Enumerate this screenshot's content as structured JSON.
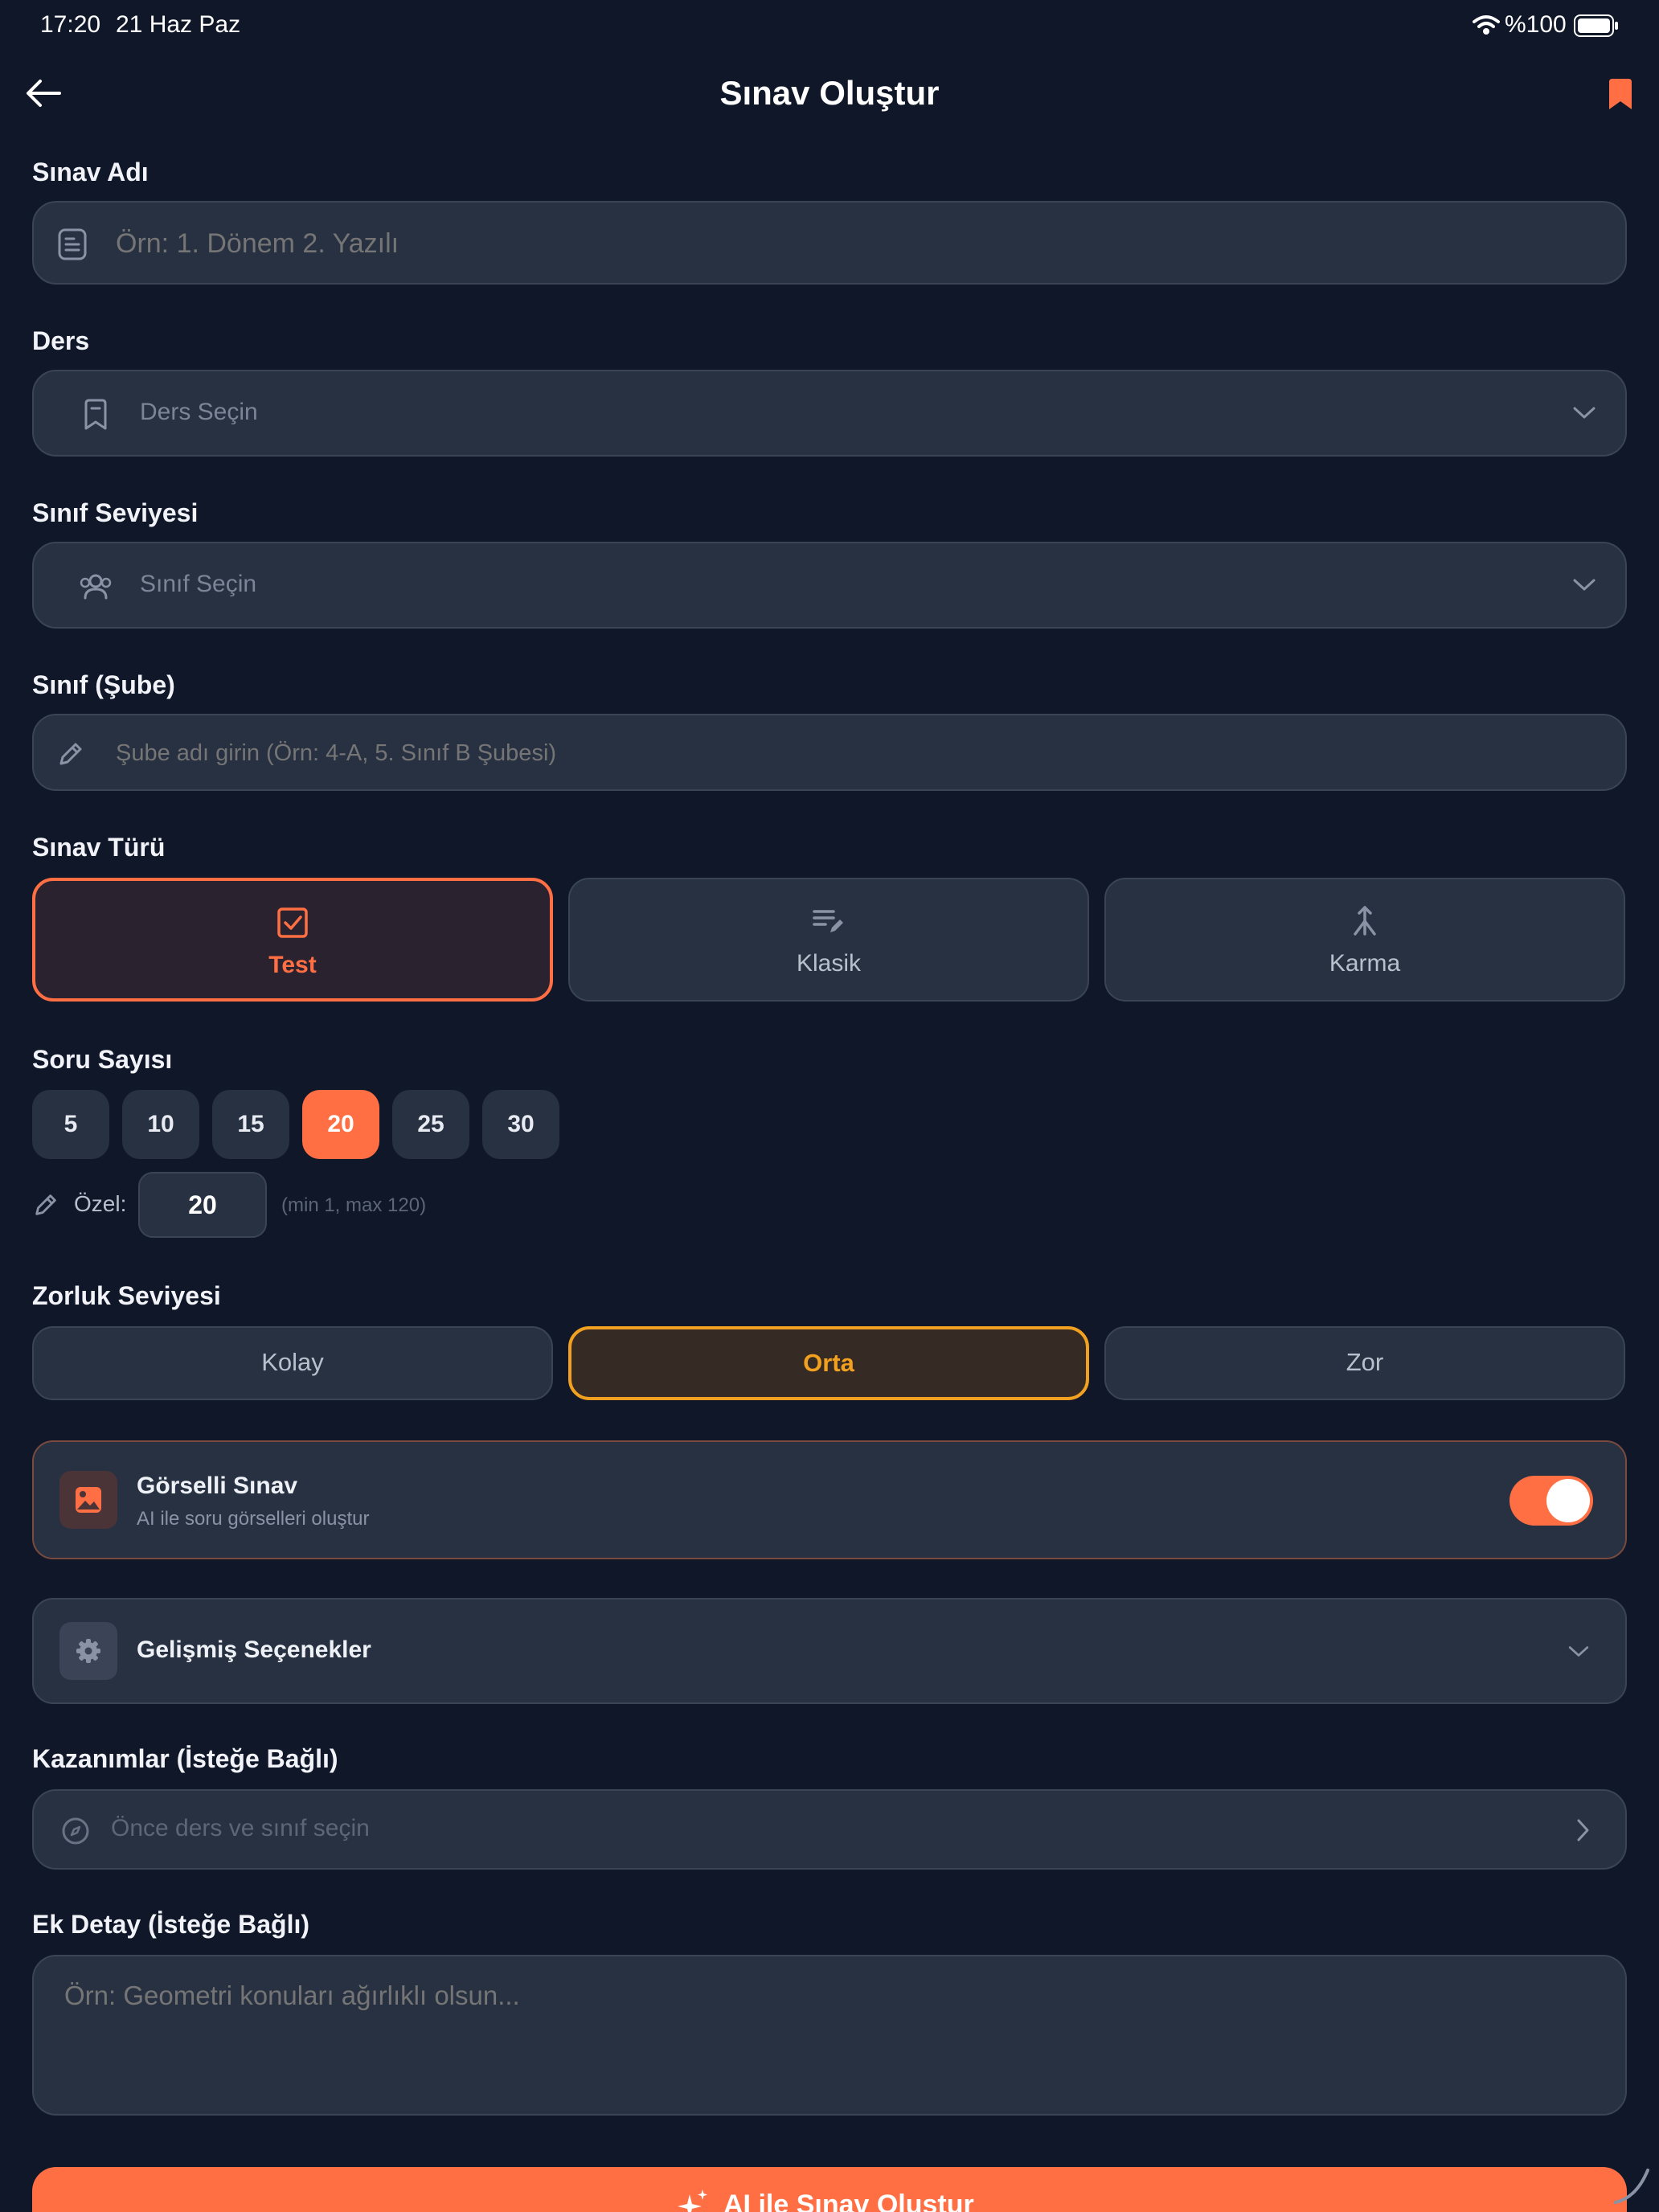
{
  "status_bar": {
    "time": "17:20",
    "date": "21 Haz Paz",
    "battery": "%100"
  },
  "header": {
    "title": "Sınav Oluştur"
  },
  "exam_name": {
    "label": "Sınav Adı",
    "placeholder": "Örn: 1. Dönem 2. Yazılı",
    "value": ""
  },
  "course": {
    "label": "Ders",
    "placeholder": "Ders Seçin"
  },
  "grade_level": {
    "label": "Sınıf Seviyesi",
    "placeholder": "Sınıf Seçin"
  },
  "branch": {
    "label": "Sınıf (Şube)",
    "placeholder": "Şube adı girin (Örn: 4-A, 5. Sınıf B Şubesi)",
    "value": ""
  },
  "exam_type": {
    "label": "Sınav Türü",
    "options": [
      {
        "label": "Test",
        "icon": "checkbox-icon",
        "selected": true
      },
      {
        "label": "Klasik",
        "icon": "edit-lines-icon",
        "selected": false
      },
      {
        "label": "Karma",
        "icon": "merge-icon",
        "selected": false
      }
    ]
  },
  "question_count": {
    "label": "Soru Sayısı",
    "options": [
      "5",
      "10",
      "15",
      "20",
      "25",
      "30"
    ],
    "selected": "20",
    "custom_label": "Özel:",
    "custom_value": "20",
    "custom_hint": "(min 1, max 120)"
  },
  "difficulty": {
    "label": "Zorluk Seviyesi",
    "options": [
      {
        "label": "Kolay",
        "selected": false
      },
      {
        "label": "Orta",
        "selected": true
      },
      {
        "label": "Zor",
        "selected": false
      }
    ]
  },
  "visual_exam": {
    "title": "Görselli Sınav",
    "subtitle": "AI ile soru görselleri oluştur",
    "enabled": true
  },
  "advanced": {
    "title": "Gelişmiş Seçenekler"
  },
  "outcomes": {
    "label": "Kazanımlar (İsteğe Bağlı)",
    "placeholder": "Önce ders ve sınıf seçin"
  },
  "extra_detail": {
    "label": "Ek Detay (İsteğe Bağlı)",
    "placeholder": "Örn: Geometri konuları ağırlıklı olsun..."
  },
  "submit": {
    "label": "AI ile Sınav Oluştur"
  },
  "colors": {
    "accent": "#ff6f43",
    "medium": "#f2a01f",
    "background": "#0f1729",
    "field": "#283142"
  }
}
